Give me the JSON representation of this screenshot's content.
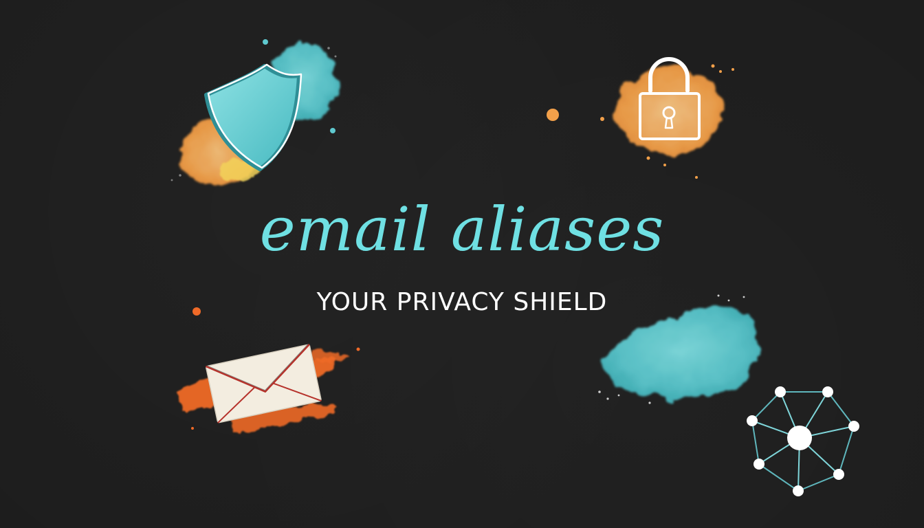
{
  "title": "email aliases",
  "subtitle": "YOUR PRIVACY SHIELD",
  "colors": {
    "background": "#1d1d1d",
    "title": "#6fe0e3",
    "subtitle": "#ffffff",
    "teal_accent": "#5fc9cf",
    "orange_accent": "#f2a04a",
    "red_orange_accent": "#ef6a28",
    "envelope_paper": "#f3ede0",
    "envelope_line": "#b6322b"
  },
  "icons": [
    "shield-icon",
    "padlock-icon",
    "envelope-icon",
    "network-icon"
  ]
}
